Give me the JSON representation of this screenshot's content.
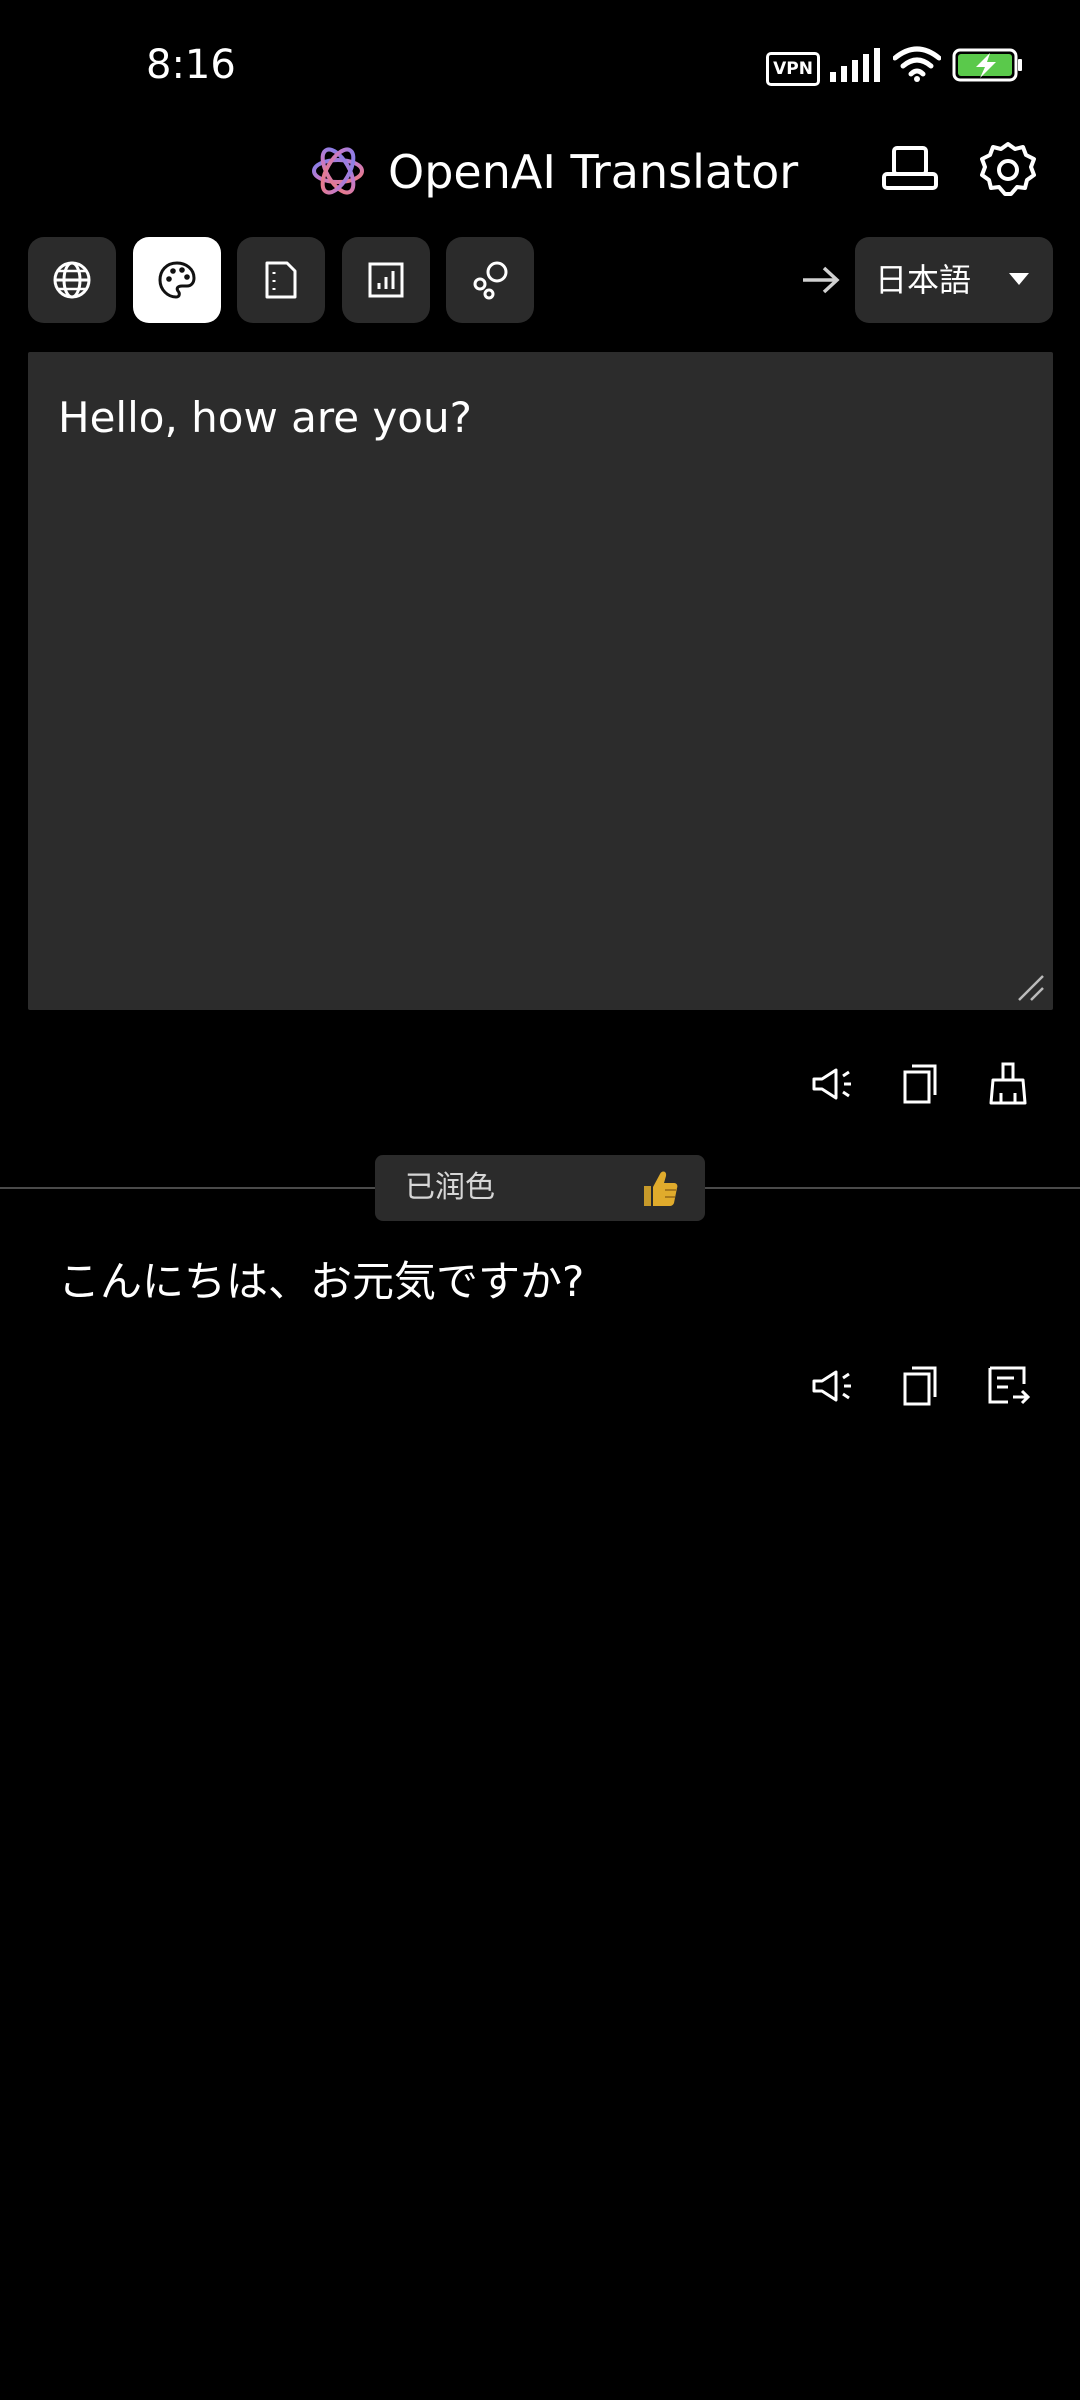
{
  "status_bar": {
    "time": "8:16",
    "vpn_label": "VPN"
  },
  "header": {
    "title": "OpenAI Translator"
  },
  "toolbar": {
    "modes": [
      {
        "icon": "globe-icon",
        "active": false
      },
      {
        "icon": "palette-icon",
        "active": true
      },
      {
        "icon": "document-icon",
        "active": false
      },
      {
        "icon": "chart-icon",
        "active": false
      },
      {
        "icon": "bubbles-icon",
        "active": false
      }
    ],
    "target_language": "日本語"
  },
  "input": {
    "text": "Hello, how are you?"
  },
  "result": {
    "status_label": "已润色",
    "status_emoji": "👍",
    "text": "こんにちは、お元気ですか?"
  },
  "colors": {
    "background": "#000000",
    "surface": "#2b2b2b",
    "battery_green": "#5ac94b"
  }
}
